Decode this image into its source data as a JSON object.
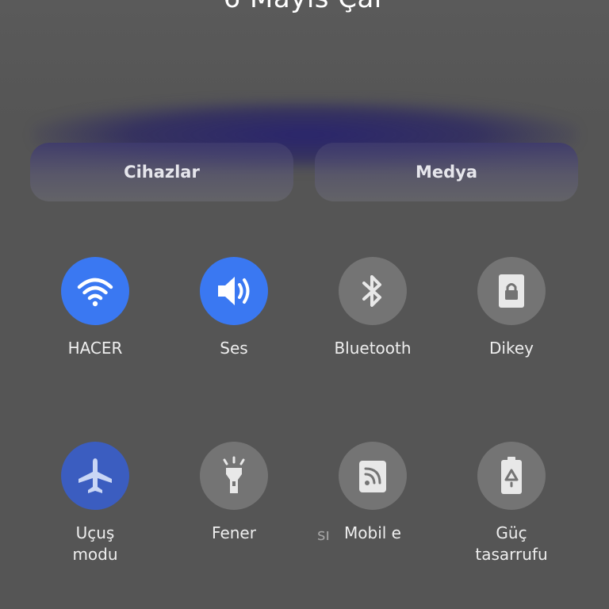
{
  "header": {
    "date": "6 Mayıs Çar"
  },
  "quick_buttons": {
    "devices_label": "Cihazlar",
    "media_label": "Medya"
  },
  "tiles": [
    {
      "label": "HACER",
      "icon": "wifi-icon",
      "state": "active"
    },
    {
      "label": "Ses",
      "icon": "speaker-icon",
      "state": "active"
    },
    {
      "label": "Bluetooth",
      "icon": "bluetooth-icon",
      "state": "inactive"
    },
    {
      "label": "Dikey",
      "icon": "rotation-lock-icon",
      "state": "inactive"
    },
    {
      "label": "Uçuş\nmodu",
      "icon": "airplane-icon",
      "state": "active"
    },
    {
      "label": "Fener",
      "icon": "flashlight-icon",
      "state": "inactive"
    },
    {
      "label": "Mobil e",
      "icon": "mobile-data-icon",
      "state": "inactive"
    },
    {
      "label": "Güç\ntasarrufu",
      "icon": "battery-saver-icon",
      "state": "inactive"
    }
  ],
  "ghost_fragment": "sı",
  "colors": {
    "background": "#555555",
    "active_blue": "#3a78f2",
    "airplane_blue": "#3b5dc0",
    "inactive_gray": "#747474"
  }
}
